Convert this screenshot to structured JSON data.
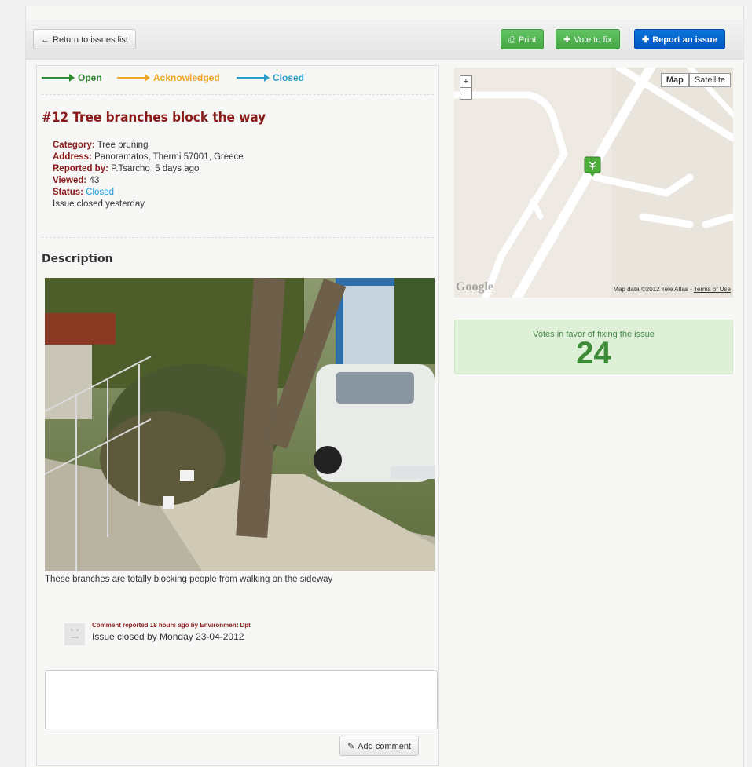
{
  "toolbar": {
    "return_label": "Return to issues list",
    "print_label": "Print",
    "vote_label": "Vote to fix",
    "report_label": "Report an issue"
  },
  "status_flow": [
    {
      "label": "Open",
      "color": "#2e8b2e"
    },
    {
      "label": "Acknowledged",
      "color": "#f0a524"
    },
    {
      "label": "Closed",
      "color": "#2a9ec9"
    }
  ],
  "issue": {
    "title": "#12 Tree branches block the way",
    "category_label": "Category:",
    "category": "Tree pruning",
    "address_label": "Address:",
    "address": "Panoramatos, Thermi 57001, Greece",
    "reported_label": "Reported by:",
    "reported_by": "P.Tsarcho  5 days ago",
    "viewed_label": "Viewed:",
    "viewed": "43",
    "status_label": "Status:",
    "status": "Closed",
    "closed_note": "Issue closed yesterday"
  },
  "description": {
    "heading": "Description",
    "caption": "These branches are totally blocking people from walking on the sideway"
  },
  "comment": {
    "meta": "Comment reported 18 hours ago by Environment Dpt",
    "text": "Issue closed by Monday 23-04-2012"
  },
  "comment_form": {
    "value": "",
    "button_label": "Add comment"
  },
  "map": {
    "zoom_in": "+",
    "zoom_out": "−",
    "type_map": "Map",
    "type_satellite": "Satellite",
    "logo": "Google",
    "attribution": "Map data ©2012 Tele Atlas - ",
    "terms": "Terms of Use"
  },
  "votes": {
    "label": "Votes in favor of fixing the issue",
    "count": "24"
  },
  "colors": {
    "title_red": "#8b1a1a",
    "vote_green": "#3d8b36",
    "report_blue": "#0055c4"
  }
}
